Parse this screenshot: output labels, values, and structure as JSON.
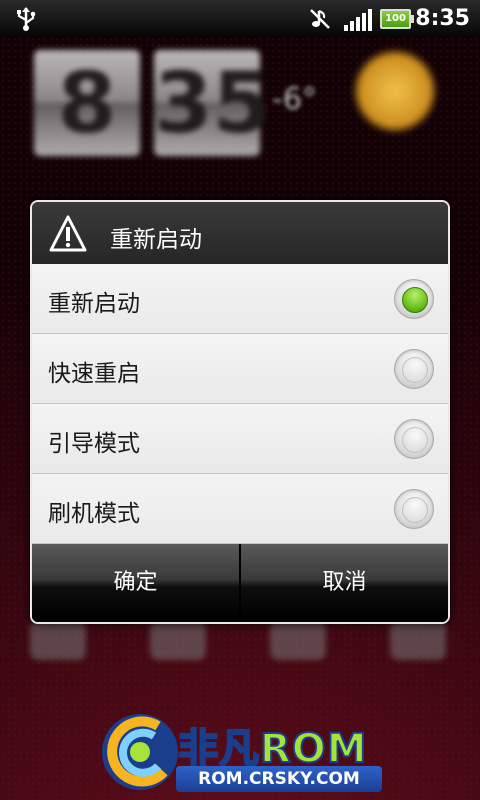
{
  "status_bar": {
    "time": "8:35",
    "battery_level": "100",
    "icons": [
      "usb-icon",
      "muted-icon",
      "signal-icon",
      "battery-icon"
    ]
  },
  "background": {
    "clock_hour": "8",
    "clock_minute": "35",
    "temperature": "-6°"
  },
  "dialog": {
    "title": "重新启动",
    "icon": "alert-icon",
    "options": [
      {
        "label": "重新启动",
        "selected": true
      },
      {
        "label": "快速重启",
        "selected": false
      },
      {
        "label": "引导模式",
        "selected": false
      },
      {
        "label": "刷机模式",
        "selected": false
      }
    ],
    "buttons": {
      "ok": "确定",
      "cancel": "取消"
    }
  },
  "watermark": {
    "title_part1": "非凡",
    "title_part2": "ROM",
    "url": "ROM.CRSKY.COM"
  },
  "colors": {
    "selected_radio": "#6cc21e",
    "dialog_border": "#e9e9e9",
    "list_background": "#f0f0f0"
  }
}
